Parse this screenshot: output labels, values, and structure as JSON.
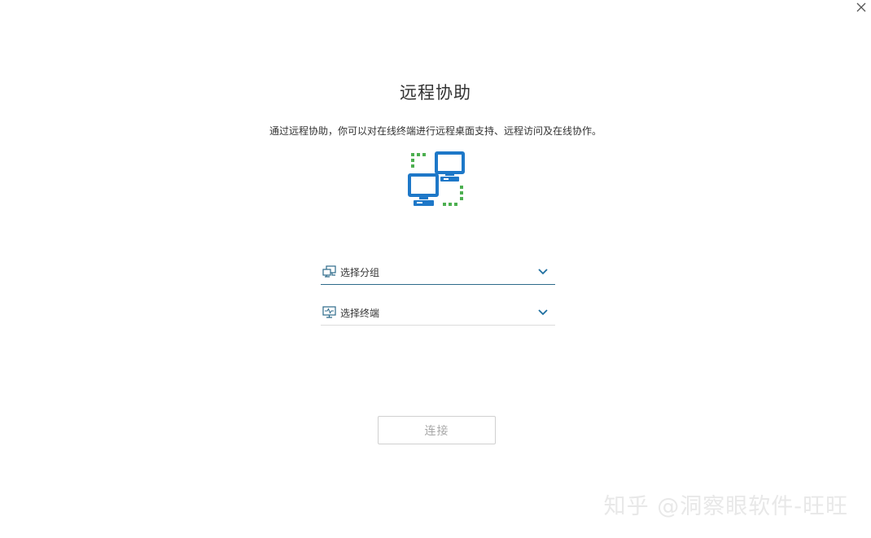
{
  "window": {
    "close_icon": "close-icon"
  },
  "header": {
    "title": "远程协助",
    "description": "通过远程协助，你可以对在线终端进行远程桌面支持、远程访问及在线协作。"
  },
  "hero": {
    "icon": "remote-computers-icon",
    "colors": {
      "monitor": "#1e78c8",
      "link": "#4caf50"
    }
  },
  "form": {
    "group_select": {
      "value": "选择分组",
      "icon": "network-group-icon",
      "chevron": "chevron-down-icon"
    },
    "terminal_select": {
      "value": "选择终端",
      "icon": "terminal-monitor-icon",
      "chevron": "chevron-down-icon"
    },
    "connect_label": "连接"
  },
  "watermark": {
    "text": "知乎 @洞察眼软件-旺旺"
  },
  "colors": {
    "accent": "#1e6fa0",
    "text": "#333333",
    "disabled": "#a8a8a8"
  }
}
